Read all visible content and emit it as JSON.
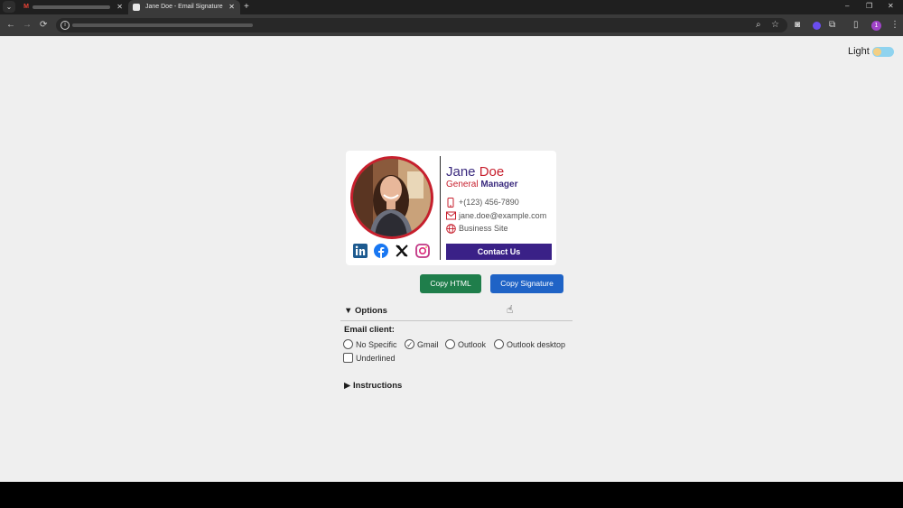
{
  "browser": {
    "tab_dropdown_icon": "chevron-down-icon",
    "tab1": {
      "favicon": "M",
      "close": "✕"
    },
    "tab2": {
      "title": "Jane Doe - Email Signature",
      "close": "✕"
    },
    "new_tab": "+",
    "window": {
      "minimize": "–",
      "restore": "❐",
      "close": "✕"
    },
    "nav": {
      "back": "←",
      "forward": "→",
      "reload": "⟳"
    },
    "profile_initial": "1"
  },
  "theme": {
    "label": "Light"
  },
  "signature": {
    "first_name": "Jane",
    "last_name": "Doe",
    "role_prefix": "General",
    "role_main": "Manager",
    "phone": "+(123) 456-7890",
    "email": "jane.doe@example.com",
    "website": "Business Site",
    "cta": "Contact Us",
    "colors": {
      "primary": "#3a2a7e",
      "accent": "#c71f2d",
      "button": "#3a2187"
    },
    "socials": [
      "linkedin-icon",
      "facebook-icon",
      "x-icon",
      "instagram-icon"
    ]
  },
  "actions": {
    "copy_html": "Copy HTML",
    "copy_signature": "Copy Signature"
  },
  "options": {
    "toggle": "▼",
    "title": "Options",
    "email_client_label": "Email client:",
    "clients": [
      "No Specific",
      "Gmail",
      "Outlook",
      "Outlook desktop"
    ],
    "selected_client": "Gmail",
    "underlined_label": "Underlined",
    "underlined": false
  },
  "instructions": {
    "toggle": "▶",
    "title": "Instructions"
  }
}
